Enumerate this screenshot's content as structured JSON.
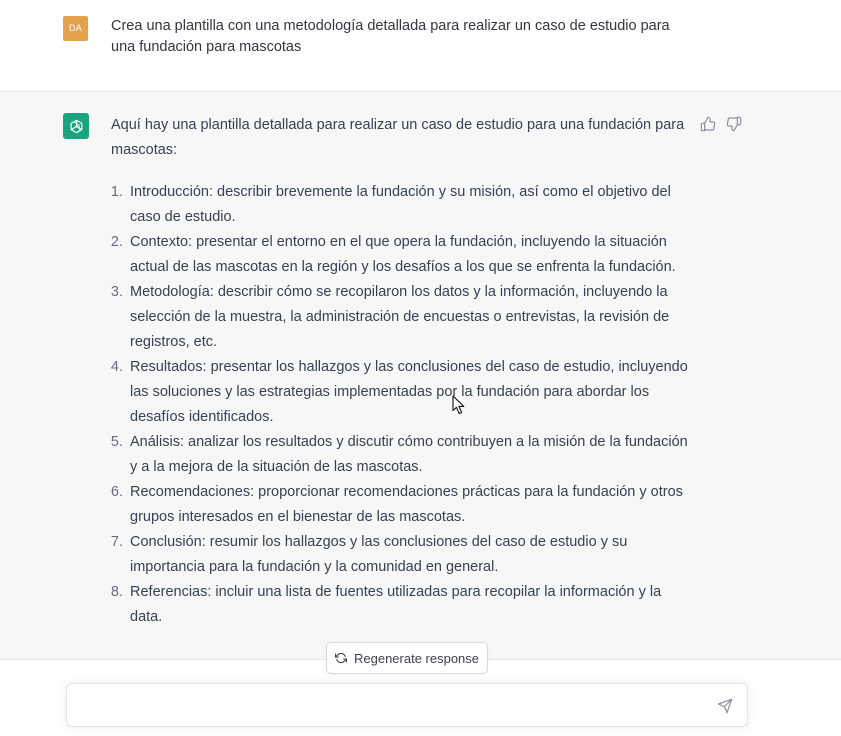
{
  "user_message": {
    "avatar_initials": "DA",
    "text": "Crea una plantilla con una metodología detallada para realizar un caso de estudio para una fundación para mascotas"
  },
  "assistant_message": {
    "intro": "Aquí hay una plantilla detallada para realizar un caso de estudio para una fundación para mascotas:",
    "steps": [
      {
        "num": "1.",
        "text": "Introducción: describir brevemente la fundación y su misión, así como el objetivo del caso de estudio."
      },
      {
        "num": "2.",
        "text": "Contexto: presentar el entorno en el que opera la fundación, incluyendo la situación actual de las mascotas en la región y los desafíos a los que se enfrenta la fundación."
      },
      {
        "num": "3.",
        "text": "Metodología: describir cómo se recopilaron los datos y la información, incluyendo la selección de la muestra, la administración de encuestas o entrevistas, la revisión de registros, etc."
      },
      {
        "num": "4.",
        "text": "Resultados: presentar los hallazgos y las conclusiones del caso de estudio, incluyendo las soluciones y las estrategias implementadas por la fundación para abordar los desafíos identificados."
      },
      {
        "num": "5.",
        "text": "Análisis: analizar los resultados y discutir cómo contribuyen a la misión de la fundación y a la mejora de la situación de las mascotas."
      },
      {
        "num": "6.",
        "text": "Recomendaciones: proporcionar recomendaciones prácticas para la fundación y otros grupos interesados en el bienestar de las mascotas."
      },
      {
        "num": "7.",
        "text": "Conclusión: resumir los hallazgos y las conclusiones del caso de estudio y su importancia para la fundación y la comunidad en general."
      },
      {
        "num": "8.",
        "text": "Referencias: incluir una lista de fuentes utilizadas para recopilar la información y la data."
      }
    ]
  },
  "controls": {
    "regenerate_label": "Regenerate response",
    "input_placeholder": "",
    "icons": {
      "assistant_avatar": "openai-logo-icon",
      "thumbs_up": "thumbs-up-icon",
      "thumbs_down": "thumbs-down-icon",
      "regenerate": "refresh-icon",
      "send": "send-icon"
    }
  },
  "colors": {
    "user_avatar": "#e4a24d",
    "assistant_avatar": "#19a37e",
    "assistant_bg": "#f7f7f8",
    "text": "#374151"
  }
}
